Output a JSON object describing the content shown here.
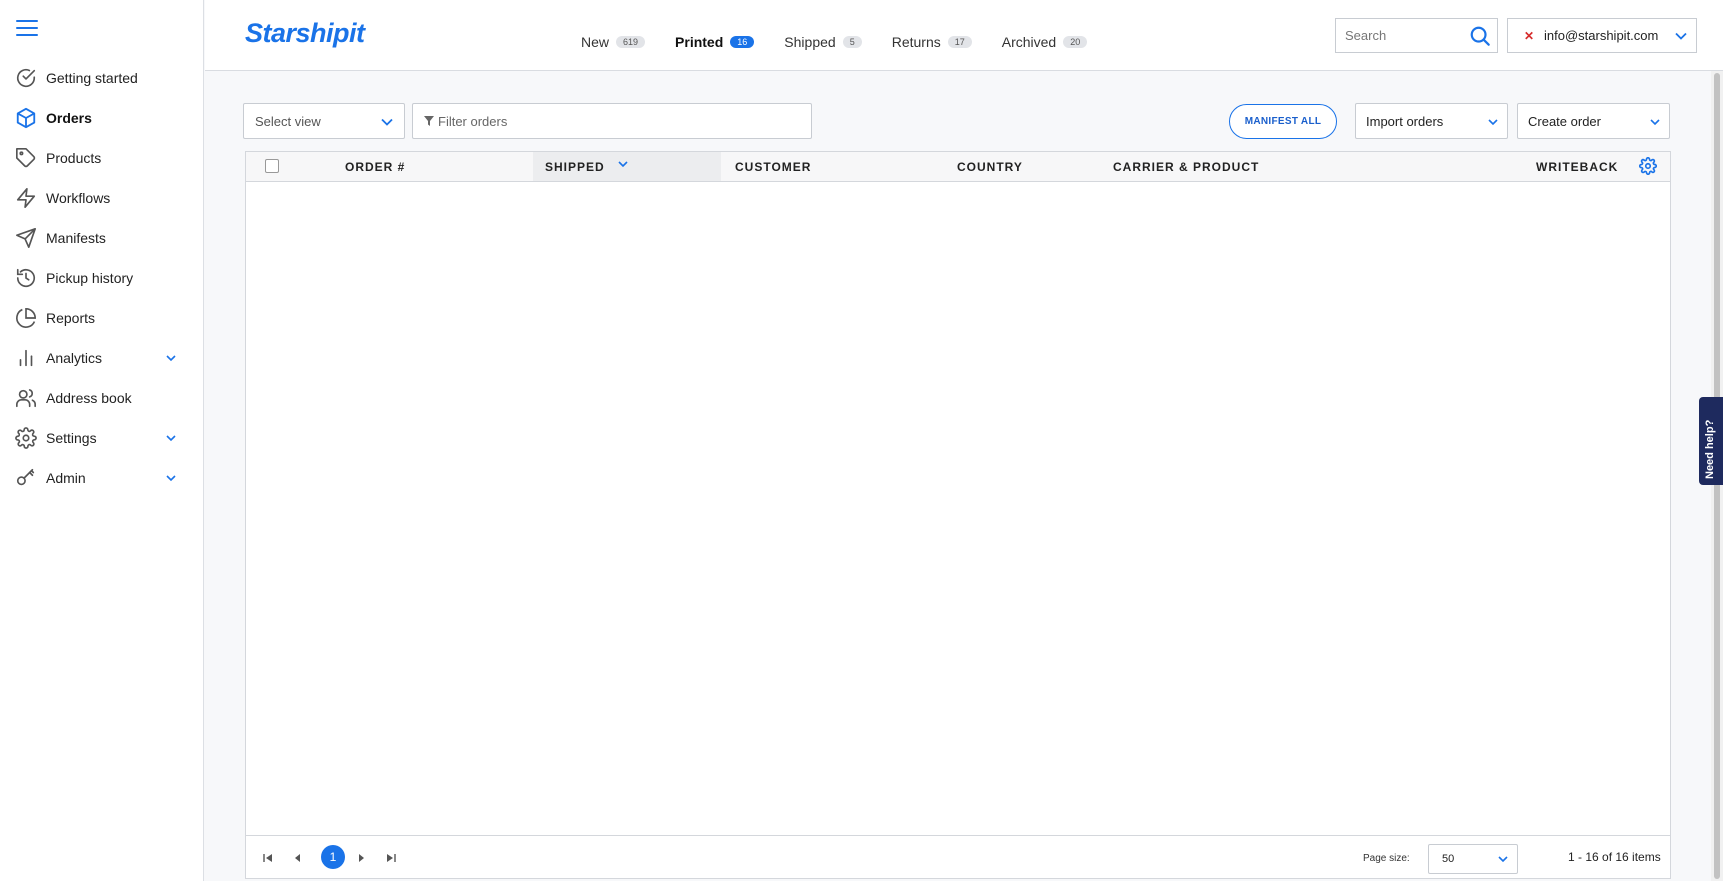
{
  "brand": {
    "logo": "Starshipit",
    "accent": "#1a73e8"
  },
  "sidebar": {
    "items": [
      {
        "label": "Getting started",
        "icon": "check-circle-icon"
      },
      {
        "label": "Orders",
        "icon": "box-icon",
        "active": true
      },
      {
        "label": "Products",
        "icon": "tag-icon"
      },
      {
        "label": "Workflows",
        "icon": "lightning-icon"
      },
      {
        "label": "Manifests",
        "icon": "send-icon"
      },
      {
        "label": "Pickup history",
        "icon": "history-icon"
      },
      {
        "label": "Reports",
        "icon": "pie-chart-icon"
      },
      {
        "label": "Analytics",
        "icon": "bar-chart-icon",
        "expandable": true
      },
      {
        "label": "Address book",
        "icon": "users-icon"
      },
      {
        "label": "Settings",
        "icon": "gear-icon",
        "expandable": true
      },
      {
        "label": "Admin",
        "icon": "key-icon",
        "expandable": true
      }
    ]
  },
  "header": {
    "tabs": [
      {
        "label": "New",
        "count": "619"
      },
      {
        "label": "Printed",
        "count": "16",
        "active": true
      },
      {
        "label": "Shipped",
        "count": "5"
      },
      {
        "label": "Returns",
        "count": "17"
      },
      {
        "label": "Archived",
        "count": "20"
      }
    ],
    "search_placeholder": "Search",
    "account_email": "info@starshipit.com"
  },
  "toolbar": {
    "select_view": "Select view",
    "filter_placeholder": "Filter orders",
    "manifest_all": "MANIFEST ALL",
    "import_orders": "Import orders",
    "create_order": "Create order"
  },
  "grid": {
    "columns": [
      "ORDER #",
      "SHIPPED",
      "CUSTOMER",
      "COUNTRY",
      "CARRIER & PRODUCT",
      "WRITEBACK"
    ],
    "sorted_column": "SHIPPED",
    "rows": []
  },
  "pager": {
    "current_page": "1",
    "page_size_label": "Page size:",
    "page_size": "50",
    "items_text": "1 - 16 of 16 items"
  },
  "help": {
    "label": "Need help?"
  }
}
